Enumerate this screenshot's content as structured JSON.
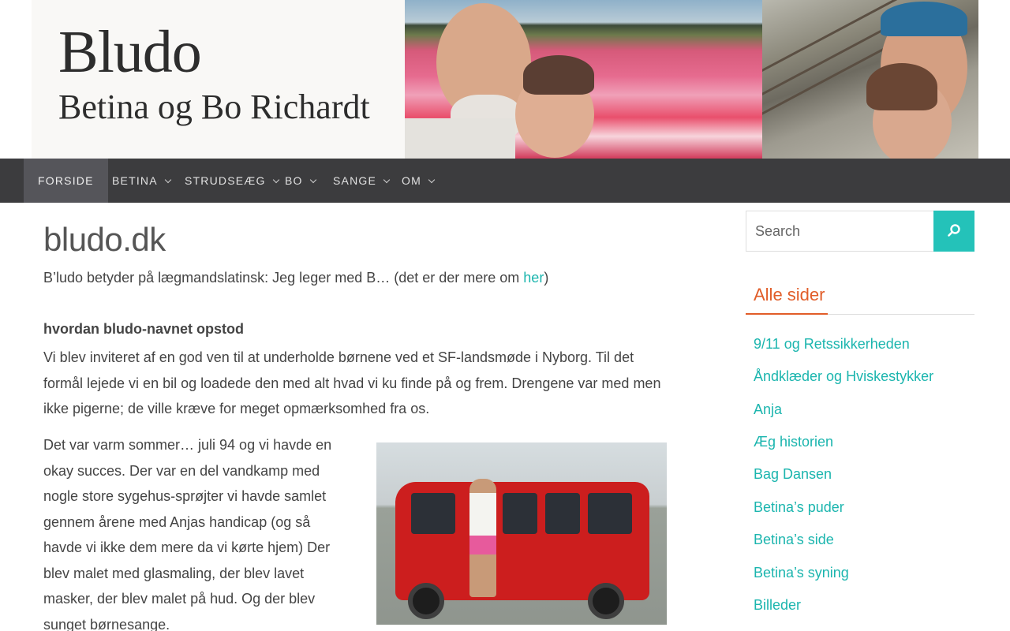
{
  "header": {
    "site_title": "Bludo",
    "site_description": "Betina og Bo Richardt"
  },
  "nav": {
    "items": [
      {
        "label": "Forside",
        "active": true,
        "has_dropdown": false
      },
      {
        "label": "Betina",
        "active": false,
        "has_dropdown": true
      },
      {
        "label": "Strudseæg",
        "active": false,
        "has_dropdown": true
      },
      {
        "label": "Bo",
        "active": false,
        "has_dropdown": true
      },
      {
        "label": "Sange",
        "active": false,
        "has_dropdown": true
      },
      {
        "label": "Om",
        "active": false,
        "has_dropdown": true
      }
    ]
  },
  "main": {
    "title": "bludo.dk",
    "intro_text": "B’ludo betyder på lægmandslatinsk: Jeg leger med B… (det er der mere om ",
    "intro_link": "her",
    "intro_close": ")",
    "subheading": "hvordan bludo-navnet opstod",
    "paragraph1": "Vi blev inviteret af en god ven til at underholde børnene ved et SF-landsmøde i Nyborg. Til det formål lejede vi en bil og loadede den med alt hvad vi ku finde på og frem. Drengene var med men ikke pigerne; de ville kræve for meget opmærksomhed fra os.",
    "paragraph2": "Det var varm sommer… juli 94 og vi havde en okay succes. Der var en del vandkamp med nogle store sygehus-sprøjter vi havde samlet gennem årene med Anjas handicap (og så havde vi ikke dem mere da vi kørte hjem) Der blev malet med glasmaling, der blev lavet masker, der blev malet på hud. Og der blev sunget børnesange."
  },
  "sidebar": {
    "search_placeholder": "Search",
    "widget_title": "Alle sider",
    "pages": [
      "9/11 og Retssikkerheden",
      "Åndklæder og Hviskestykker",
      "Anja",
      "Æg historien",
      "Bag Dansen",
      "Betina’s puder",
      "Betina’s side",
      "Betina’s syning",
      "Billeder"
    ]
  },
  "colors": {
    "accent_teal": "#24c2b9",
    "link_teal": "#1bb5ae",
    "widget_title_orange": "#e15d29",
    "nav_background": "#3c3c3e"
  }
}
